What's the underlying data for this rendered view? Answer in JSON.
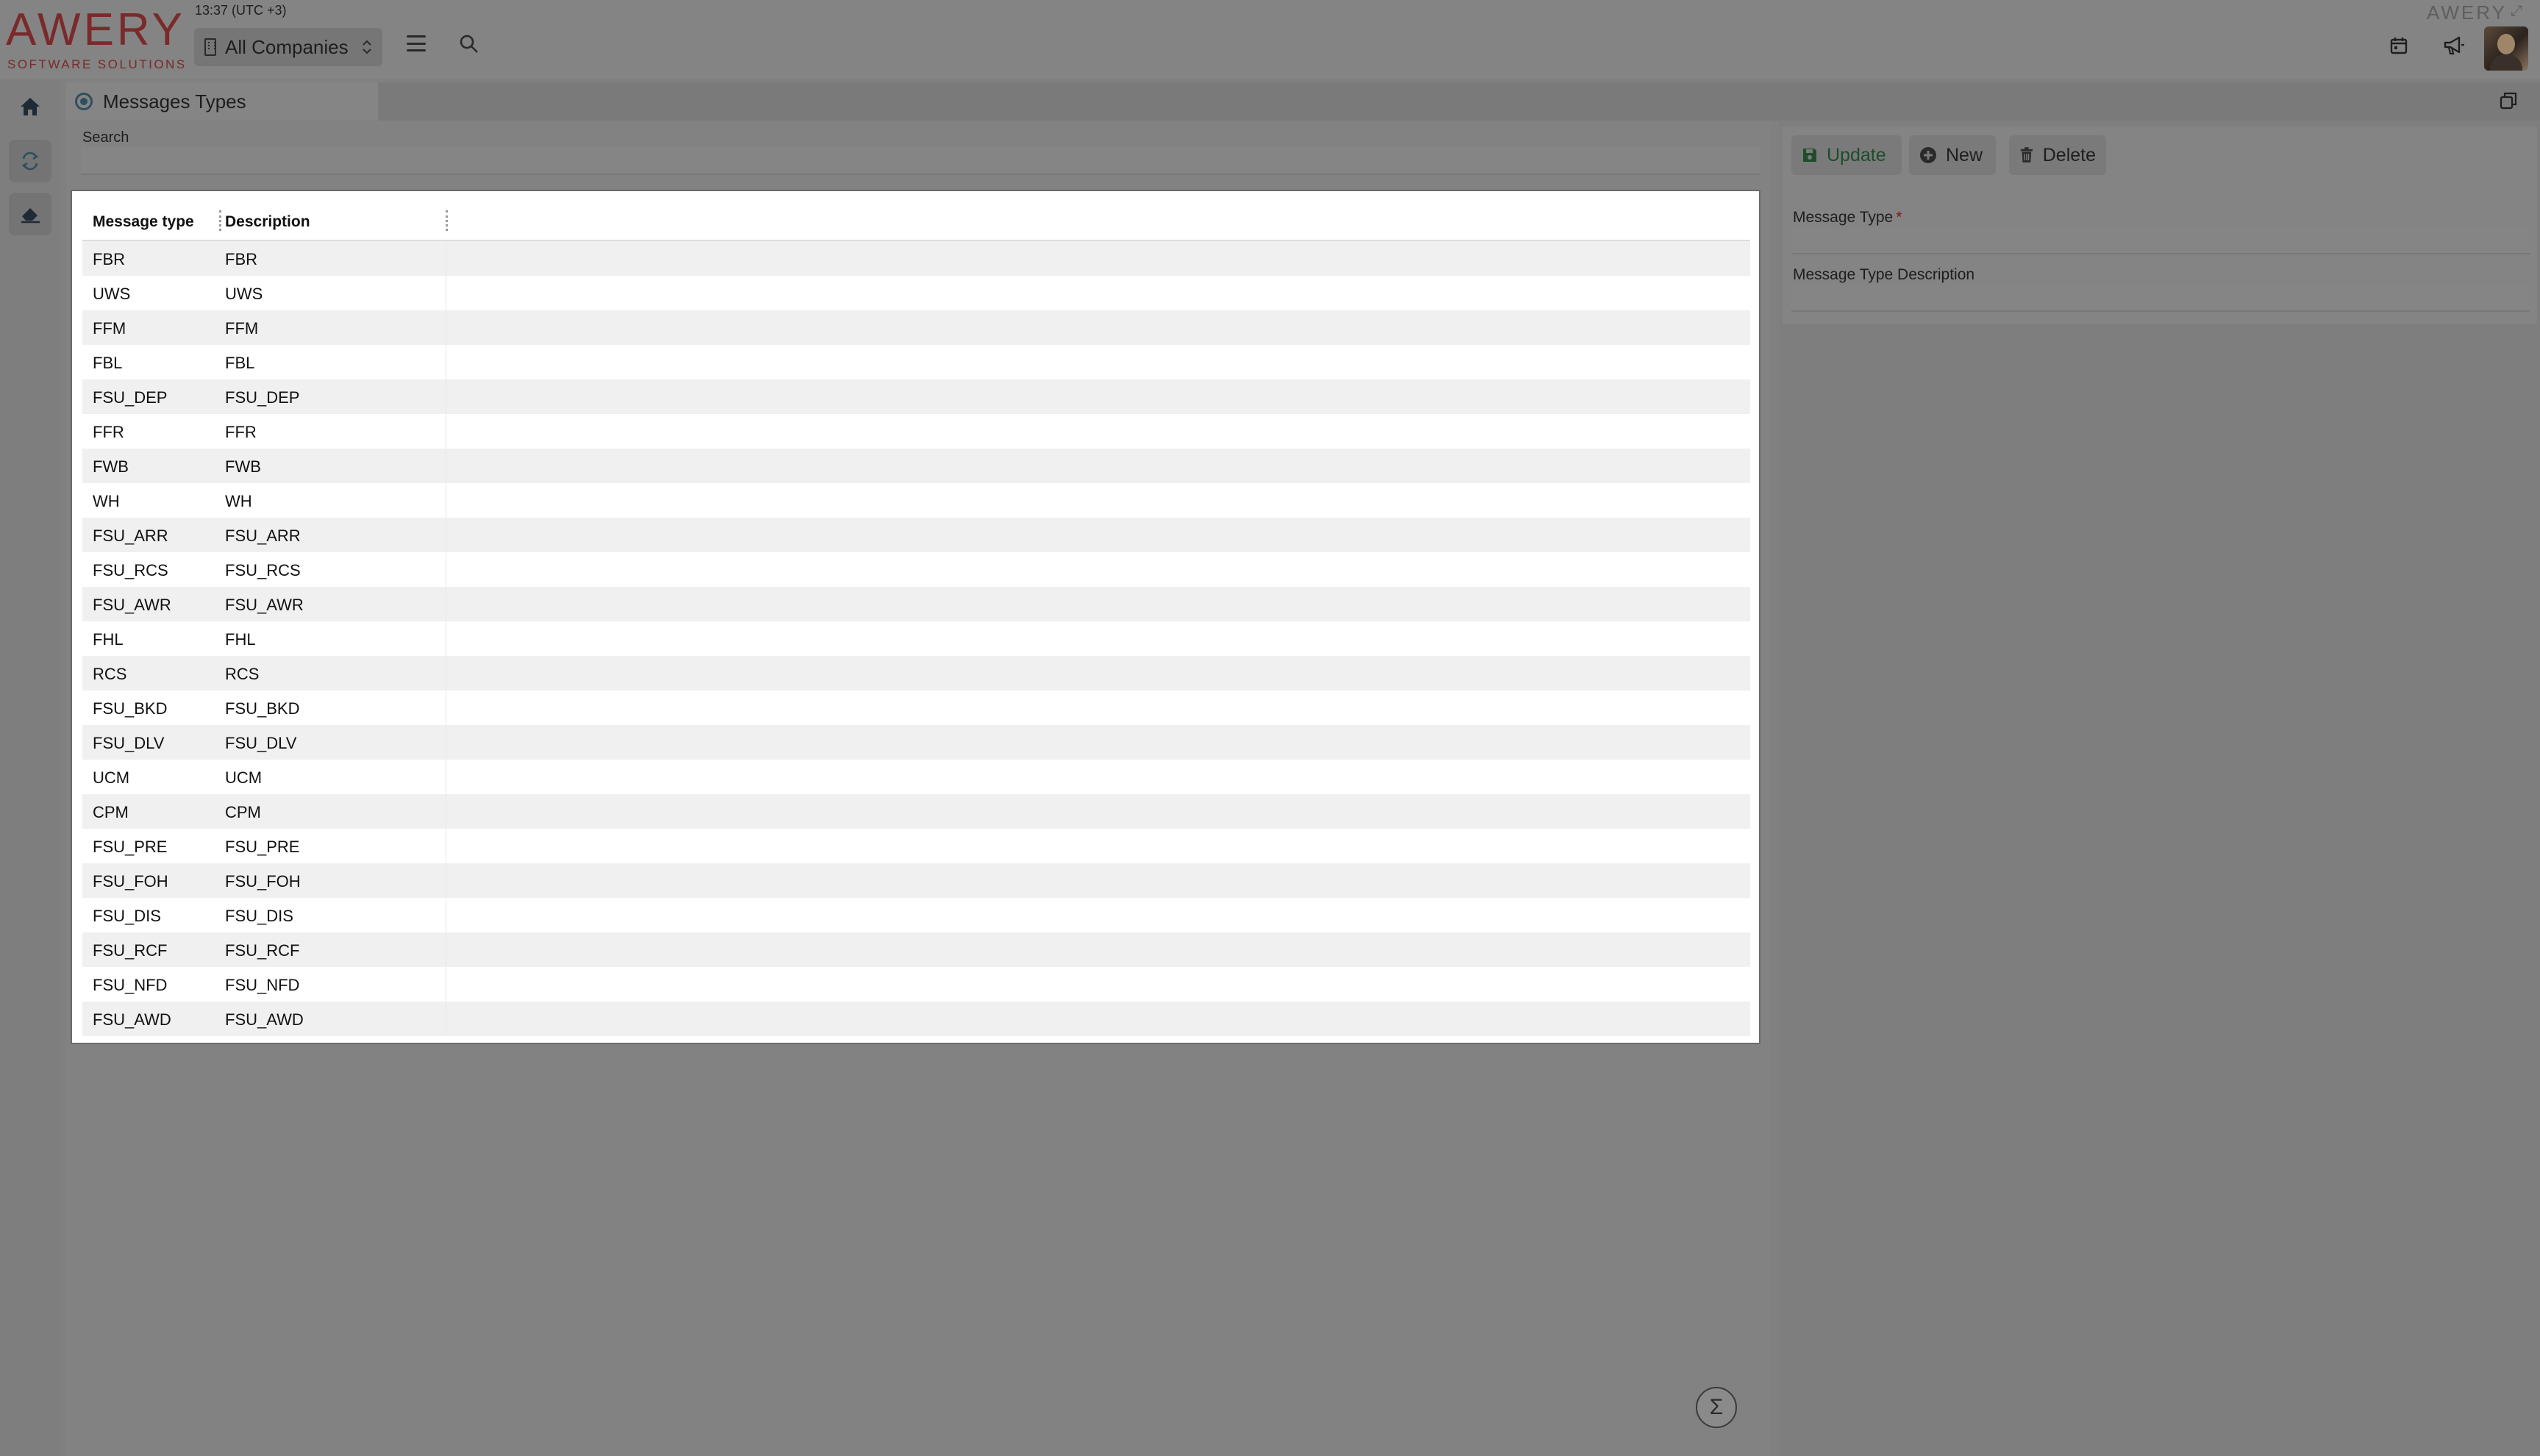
{
  "header": {
    "logo_text": "AWERY",
    "logo_sub": "SOFTWARE SOLUTIONS",
    "time": "13:37 (UTC +3)",
    "company_selector": "All Companies",
    "brand_right": "AWERY"
  },
  "tab": {
    "title": "Messages Types"
  },
  "search": {
    "label": "Search",
    "value": ""
  },
  "grid": {
    "columns": [
      "Message type",
      "Description"
    ],
    "rows": [
      [
        "FBR",
        "FBR"
      ],
      [
        "UWS",
        "UWS"
      ],
      [
        "FFM",
        "FFM"
      ],
      [
        "FBL",
        "FBL"
      ],
      [
        "FSU_DEP",
        "FSU_DEP"
      ],
      [
        "FFR",
        "FFR"
      ],
      [
        "FWB",
        "FWB"
      ],
      [
        "WH",
        "WH"
      ],
      [
        "FSU_ARR",
        "FSU_ARR"
      ],
      [
        "FSU_RCS",
        "FSU_RCS"
      ],
      [
        "FSU_AWR",
        "FSU_AWR"
      ],
      [
        "FHL",
        "FHL"
      ],
      [
        "RCS",
        "RCS"
      ],
      [
        "FSU_BKD",
        "FSU_BKD"
      ],
      [
        "FSU_DLV",
        "FSU_DLV"
      ],
      [
        "UCM",
        "UCM"
      ],
      [
        "CPM",
        "CPM"
      ],
      [
        "FSU_PRE",
        "FSU_PRE"
      ],
      [
        "FSU_FOH",
        "FSU_FOH"
      ],
      [
        "FSU_DIS",
        "FSU_DIS"
      ],
      [
        "FSU_RCF",
        "FSU_RCF"
      ],
      [
        "FSU_NFD",
        "FSU_NFD"
      ],
      [
        "FSU_AWD",
        "FSU_AWD"
      ]
    ]
  },
  "form": {
    "update_label": "Update",
    "new_label": "New",
    "delete_label": "Delete",
    "message_type_label": "Message Type",
    "required_mark": "*",
    "message_type_value": "",
    "description_label": "Message Type Description",
    "description_value": ""
  },
  "footer": {
    "sum_symbol": "Σ"
  },
  "colors": {
    "overlay": "#808080",
    "logo": "#7a2a2a",
    "update": "#1d4d2a",
    "required": "#8a1010"
  }
}
